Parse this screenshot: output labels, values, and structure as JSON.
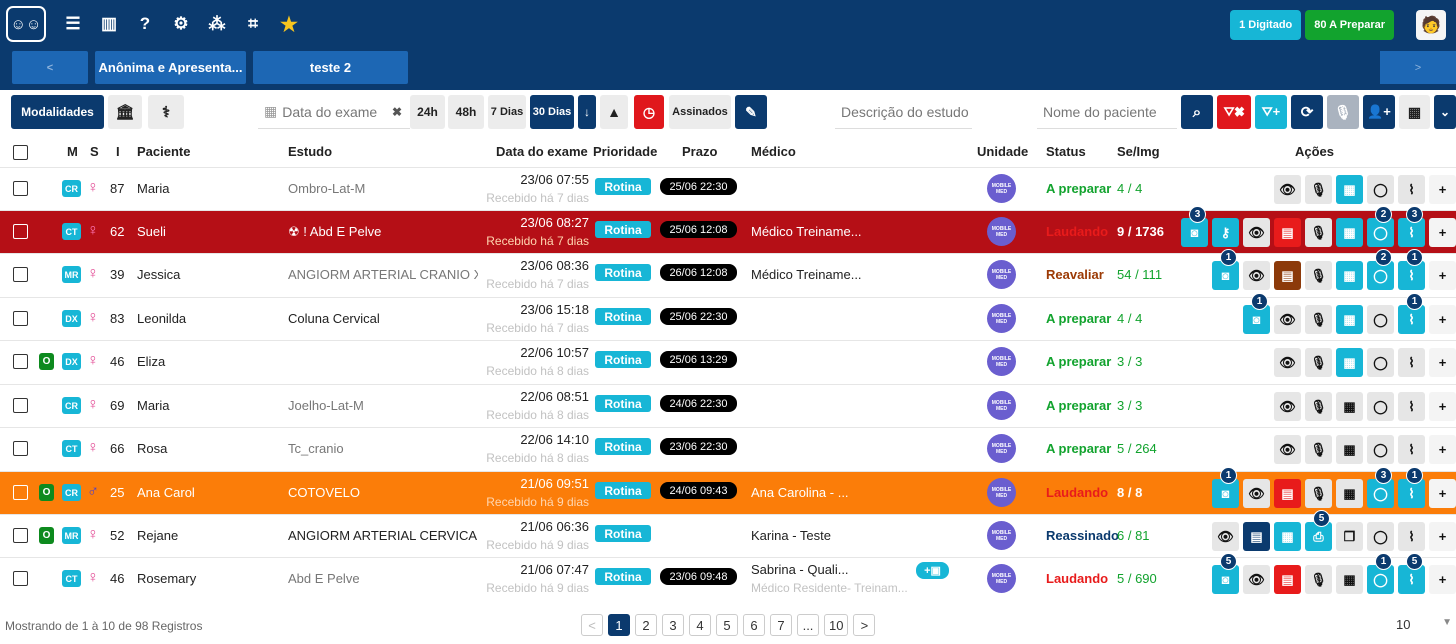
{
  "header": {
    "icons": [
      "logo-icon",
      "list-icon",
      "chart-icon",
      "help-icon",
      "gears-icon",
      "sitemap-icon",
      "scan-icon",
      "star-icon"
    ],
    "counters": {
      "digitado": "1 Digitado",
      "a_preparar": "80 A Preparar"
    },
    "tabs": {
      "prev": "<",
      "tab1": "Anônima e Apresenta...",
      "tab2": "teste 2",
      "next": ">"
    }
  },
  "toolbar": {
    "modalidades": "Modalidades",
    "date_placeholder": "Data do exame",
    "clear": "✖",
    "range_24h": "24h",
    "range_48h": "48h",
    "range_7d": "7 Dias",
    "range_30d": "30 Dias",
    "assinados": "Assinados",
    "desc_placeholder": "Descrição do estudo",
    "name_placeholder": "Nome do paciente"
  },
  "table": {
    "headers": {
      "m": "M",
      "s": "S",
      "i": "I",
      "paciente": "Paciente",
      "estudo": "Estudo",
      "data": "Data do exame",
      "prioridade": "Prioridade",
      "prazo": "Prazo",
      "medico": "Médico",
      "unidade": "Unidade",
      "status": "Status",
      "seimg": "Se/Img",
      "acoes": "Ações"
    },
    "unit_label": "MOBILE MED",
    "rows": [
      {
        "o": "",
        "mod": "CR",
        "sex": "f",
        "age": "87",
        "name": "Maria",
        "study": "Ombro-Lat-M",
        "date": "23/06 07:55",
        "received": "Recebido há 7 dias",
        "prio": "Rotina",
        "prazo": "25/06 22:30",
        "doctor": "",
        "doctor2": "",
        "status": "A preparar",
        "seimg": "4 / 4"
      },
      {
        "o": "",
        "mod": "CT",
        "sex": "f",
        "age": "62",
        "name": "Sueli",
        "study": "☢ ! Abd E Pelve",
        "date": "23/06 08:27",
        "received": "Recebido há 7 dias",
        "prio": "Rotina",
        "prazo": "25/06 12:08",
        "doctor": "Médico Treiname...",
        "doctor2": "",
        "status": "Laudando",
        "seimg": "9 / 1736"
      },
      {
        "o": "",
        "mod": "MR",
        "sex": "f",
        "age": "39",
        "name": "Jessica",
        "study": "ANGIORM ARTERIAL CRANIO X...",
        "date": "23/06 08:36",
        "received": "Recebido há 7 dias",
        "prio": "Rotina",
        "prazo": "26/06 12:08",
        "doctor": "Médico Treiname...",
        "doctor2": "",
        "status": "Reavaliar",
        "seimg": "54 / 111"
      },
      {
        "o": "",
        "mod": "DX",
        "sex": "f",
        "age": "83",
        "name": "Leonilda",
        "study": "Coluna Cervical",
        "date": "23/06 15:18",
        "received": "Recebido há 7 dias",
        "prio": "Rotina",
        "prazo": "25/06 22:30",
        "doctor": "",
        "doctor2": "",
        "status": "A preparar",
        "seimg": "4 / 4"
      },
      {
        "o": "O",
        "mod": "DX",
        "sex": "f",
        "age": "46",
        "name": "Eliza",
        "study": "",
        "date": "22/06 10:57",
        "received": "Recebido há 8 dias",
        "prio": "Rotina",
        "prazo": "25/06 13:29",
        "doctor": "",
        "doctor2": "",
        "status": "A preparar",
        "seimg": "3 / 3"
      },
      {
        "o": "",
        "mod": "CR",
        "sex": "f",
        "age": "69",
        "name": "Maria",
        "study": "Joelho-Lat-M",
        "date": "22/06 08:51",
        "received": "Recebido há 8 dias",
        "prio": "Rotina",
        "prazo": "24/06 22:30",
        "doctor": "",
        "doctor2": "",
        "status": "A preparar",
        "seimg": "3 / 3"
      },
      {
        "o": "",
        "mod": "CT",
        "sex": "f",
        "age": "66",
        "name": "Rosa",
        "study": "Tc_cranio",
        "date": "22/06 14:10",
        "received": "Recebido há 8 dias",
        "prio": "Rotina",
        "prazo": "23/06 22:30",
        "doctor": "",
        "doctor2": "",
        "status": "A preparar",
        "seimg": "5 / 264"
      },
      {
        "o": "O",
        "mod": "CR",
        "sex": "m",
        "age": "25",
        "name": "Ana Carol",
        "study": "COTOVELO",
        "date": "21/06 09:51",
        "received": "Recebido há 9 dias",
        "prio": "Rotina",
        "prazo": "24/06 09:43",
        "doctor": "Ana Carolina - ...",
        "doctor2": "",
        "status": "Laudando",
        "seimg": "8 / 8"
      },
      {
        "o": "O",
        "mod": "MR",
        "sex": "f",
        "age": "52",
        "name": "Rejane",
        "study": "ANGIORM ARTERIAL CERVICAL...",
        "date": "21/06 06:36",
        "received": "Recebido há 9 dias",
        "prio": "Rotina",
        "prazo": "",
        "doctor": "Karina - Teste",
        "doctor2": "",
        "status": "Reassinado",
        "seimg": "6 / 81"
      },
      {
        "o": "",
        "mod": "CT",
        "sex": "f",
        "age": "46",
        "name": "Rosemary",
        "study": "Abd E Pelve",
        "date": "21/06 07:47",
        "received": "Recebido há 9 dias",
        "prio": "Rotina",
        "prazo": "23/06 09:48",
        "doctor": "Sabrina - Quali...",
        "doctor2": "Médico Residente- Treinam...",
        "status": "Laudando",
        "seimg": "5 / 690"
      }
    ]
  },
  "footer": {
    "info": "Mostrando de 1 à 10 de 98 Registros",
    "pages": [
      "<",
      "1",
      "2",
      "3",
      "4",
      "5",
      "6",
      "7",
      "...",
      "10",
      ">"
    ],
    "page_size": "10"
  },
  "colors": {
    "navy": "#0b3a6e",
    "cyan": "#17b6d6",
    "row_red": "#b50f16",
    "row_orange": "#fb7d09",
    "green": "#12a32e"
  }
}
